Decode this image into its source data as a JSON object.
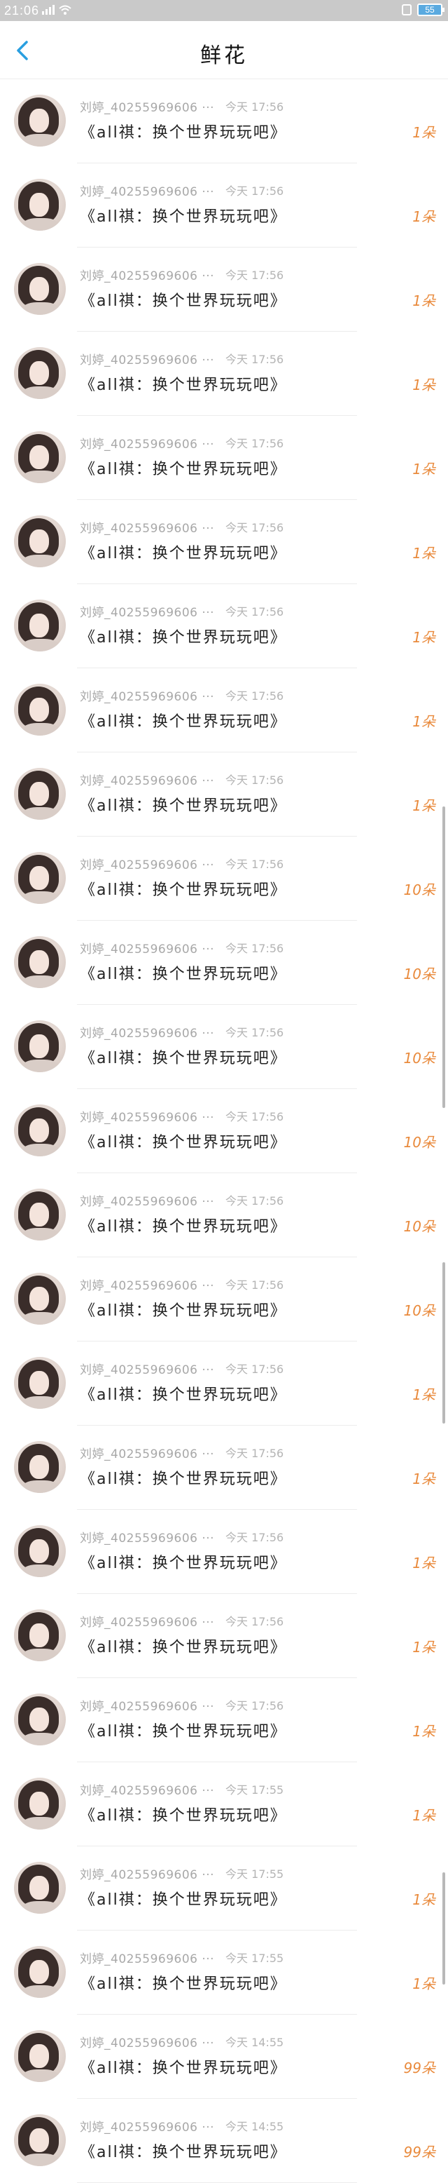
{
  "status_bar": {
    "time": "21:06",
    "battery": "55"
  },
  "header": {
    "title": "鲜花"
  },
  "items": [
    {
      "sender": "刘婷_40255969606 ···",
      "time": "今天 17:56",
      "book": "《all祺：换个世界玩玩吧》",
      "amount": "1朵"
    },
    {
      "sender": "刘婷_40255969606 ···",
      "time": "今天 17:56",
      "book": "《all祺：换个世界玩玩吧》",
      "amount": "1朵"
    },
    {
      "sender": "刘婷_40255969606 ···",
      "time": "今天 17:56",
      "book": "《all祺：换个世界玩玩吧》",
      "amount": "1朵"
    },
    {
      "sender": "刘婷_40255969606 ···",
      "time": "今天 17:56",
      "book": "《all祺：换个世界玩玩吧》",
      "amount": "1朵"
    },
    {
      "sender": "刘婷_40255969606 ···",
      "time": "今天 17:56",
      "book": "《all祺：换个世界玩玩吧》",
      "amount": "1朵"
    },
    {
      "sender": "刘婷_40255969606 ···",
      "time": "今天 17:56",
      "book": "《all祺：换个世界玩玩吧》",
      "amount": "1朵"
    },
    {
      "sender": "刘婷_40255969606 ···",
      "time": "今天 17:56",
      "book": "《all祺：换个世界玩玩吧》",
      "amount": "1朵"
    },
    {
      "sender": "刘婷_40255969606 ···",
      "time": "今天 17:56",
      "book": "《all祺：换个世界玩玩吧》",
      "amount": "1朵"
    },
    {
      "sender": "刘婷_40255969606 ···",
      "time": "今天 17:56",
      "book": "《all祺：换个世界玩玩吧》",
      "amount": "1朵"
    },
    {
      "sender": "刘婷_40255969606 ···",
      "time": "今天 17:56",
      "book": "《all祺：换个世界玩玩吧》",
      "amount": "10朵"
    },
    {
      "sender": "刘婷_40255969606 ···",
      "time": "今天 17:56",
      "book": "《all祺：换个世界玩玩吧》",
      "amount": "10朵"
    },
    {
      "sender": "刘婷_40255969606 ···",
      "time": "今天 17:56",
      "book": "《all祺：换个世界玩玩吧》",
      "amount": "10朵"
    },
    {
      "sender": "刘婷_40255969606 ···",
      "time": "今天 17:56",
      "book": "《all祺：换个世界玩玩吧》",
      "amount": "10朵"
    },
    {
      "sender": "刘婷_40255969606 ···",
      "time": "今天 17:56",
      "book": "《all祺：换个世界玩玩吧》",
      "amount": "10朵"
    },
    {
      "sender": "刘婷_40255969606 ···",
      "time": "今天 17:56",
      "book": "《all祺：换个世界玩玩吧》",
      "amount": "10朵"
    },
    {
      "sender": "刘婷_40255969606 ···",
      "time": "今天 17:56",
      "book": "《all祺：换个世界玩玩吧》",
      "amount": "1朵"
    },
    {
      "sender": "刘婷_40255969606 ···",
      "time": "今天 17:56",
      "book": "《all祺：换个世界玩玩吧》",
      "amount": "1朵"
    },
    {
      "sender": "刘婷_40255969606 ···",
      "time": "今天 17:56",
      "book": "《all祺：换个世界玩玩吧》",
      "amount": "1朵"
    },
    {
      "sender": "刘婷_40255969606 ···",
      "time": "今天 17:56",
      "book": "《all祺：换个世界玩玩吧》",
      "amount": "1朵"
    },
    {
      "sender": "刘婷_40255969606 ···",
      "time": "今天 17:56",
      "book": "《all祺：换个世界玩玩吧》",
      "amount": "1朵"
    },
    {
      "sender": "刘婷_40255969606 ···",
      "time": "今天 17:55",
      "book": "《all祺：换个世界玩玩吧》",
      "amount": "1朵"
    },
    {
      "sender": "刘婷_40255969606 ···",
      "time": "今天 17:55",
      "book": "《all祺：换个世界玩玩吧》",
      "amount": "1朵"
    },
    {
      "sender": "刘婷_40255969606 ···",
      "time": "今天 17:55",
      "book": "《all祺：换个世界玩玩吧》",
      "amount": "1朵"
    },
    {
      "sender": "刘婷_40255969606 ···",
      "time": "今天 14:55",
      "book": "《all祺：换个世界玩玩吧》",
      "amount": "99朵"
    },
    {
      "sender": "刘婷_40255969606 ···",
      "time": "今天 14:55",
      "book": "《all祺：换个世界玩玩吧》",
      "amount": "99朵"
    }
  ]
}
